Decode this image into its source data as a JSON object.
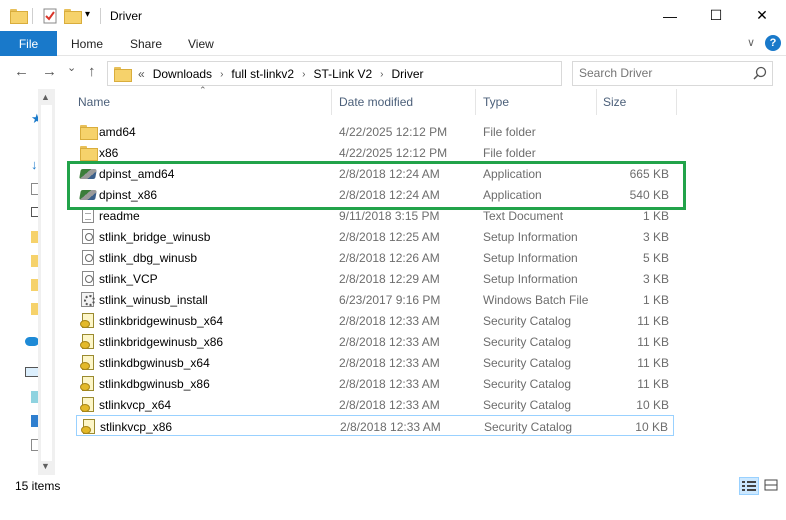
{
  "window": {
    "title": "Driver",
    "minimize_glyph": "—",
    "maximize_glyph": "☐",
    "close_glyph": "✕"
  },
  "quick_access_icons": [
    "folder-icon",
    "properties-icon",
    "new-folder-icon",
    "customize-chevron-icon"
  ],
  "ribbon": {
    "tabs": [
      {
        "label": "File",
        "active": true
      },
      {
        "label": "Home"
      },
      {
        "label": "Share"
      },
      {
        "label": "View"
      }
    ],
    "accent": "#1979ca",
    "help_glyph": "?"
  },
  "navigation": {
    "back_glyph": "←",
    "forward_glyph": "→",
    "recent_glyph": "⌄",
    "up_glyph": "↑",
    "overflow": "«",
    "breadcrumbs": [
      "Downloads",
      "full st-linkv2",
      "ST-Link V2",
      "Driver"
    ],
    "search_placeholder": "Search Driver"
  },
  "columns": {
    "name": "Name",
    "date": "Date modified",
    "type": "Type",
    "size": "Size"
  },
  "files": [
    {
      "name": "amd64",
      "date": "4/22/2025 12:12 PM",
      "type": "File folder",
      "size": "",
      "icon": "folder"
    },
    {
      "name": "x86",
      "date": "4/22/2025 12:12 PM",
      "type": "File folder",
      "size": "",
      "icon": "folder"
    },
    {
      "name": "dpinst_amd64",
      "date": "2/8/2018 12:24 AM",
      "type": "Application",
      "size": "665 KB",
      "icon": "app"
    },
    {
      "name": "dpinst_x86",
      "date": "2/8/2018 12:24 AM",
      "type": "Application",
      "size": "540 KB",
      "icon": "app"
    },
    {
      "name": "readme",
      "date": "9/11/2018 3:15 PM",
      "type": "Text Document",
      "size": "1 KB",
      "icon": "doc"
    },
    {
      "name": "stlink_bridge_winusb",
      "date": "2/8/2018 12:25 AM",
      "type": "Setup Information",
      "size": "3 KB",
      "icon": "inf"
    },
    {
      "name": "stlink_dbg_winusb",
      "date": "2/8/2018 12:26 AM",
      "type": "Setup Information",
      "size": "5 KB",
      "icon": "inf"
    },
    {
      "name": "stlink_VCP",
      "date": "2/8/2018 12:29 AM",
      "type": "Setup Information",
      "size": "3 KB",
      "icon": "inf"
    },
    {
      "name": "stlink_winusb_install",
      "date": "6/23/2017 9:16 PM",
      "type": "Windows Batch File",
      "size": "1 KB",
      "icon": "bat"
    },
    {
      "name": "stlinkbridgewinusb_x64",
      "date": "2/8/2018 12:33 AM",
      "type": "Security Catalog",
      "size": "11 KB",
      "icon": "cat"
    },
    {
      "name": "stlinkbridgewinusb_x86",
      "date": "2/8/2018 12:33 AM",
      "type": "Security Catalog",
      "size": "11 KB",
      "icon": "cat"
    },
    {
      "name": "stlinkdbgwinusb_x64",
      "date": "2/8/2018 12:33 AM",
      "type": "Security Catalog",
      "size": "11 KB",
      "icon": "cat"
    },
    {
      "name": "stlinkdbgwinusb_x86",
      "date": "2/8/2018 12:33 AM",
      "type": "Security Catalog",
      "size": "11 KB",
      "icon": "cat"
    },
    {
      "name": "stlinkvcp_x64",
      "date": "2/8/2018 12:33 AM",
      "type": "Security Catalog",
      "size": "10 KB",
      "icon": "cat"
    },
    {
      "name": "stlinkvcp_x86",
      "date": "2/8/2018 12:33 AM",
      "type": "Security Catalog",
      "size": "10 KB",
      "icon": "cat",
      "selected": true
    }
  ],
  "highlight_color": "#22a34a",
  "status": {
    "item_count": "15 items"
  }
}
